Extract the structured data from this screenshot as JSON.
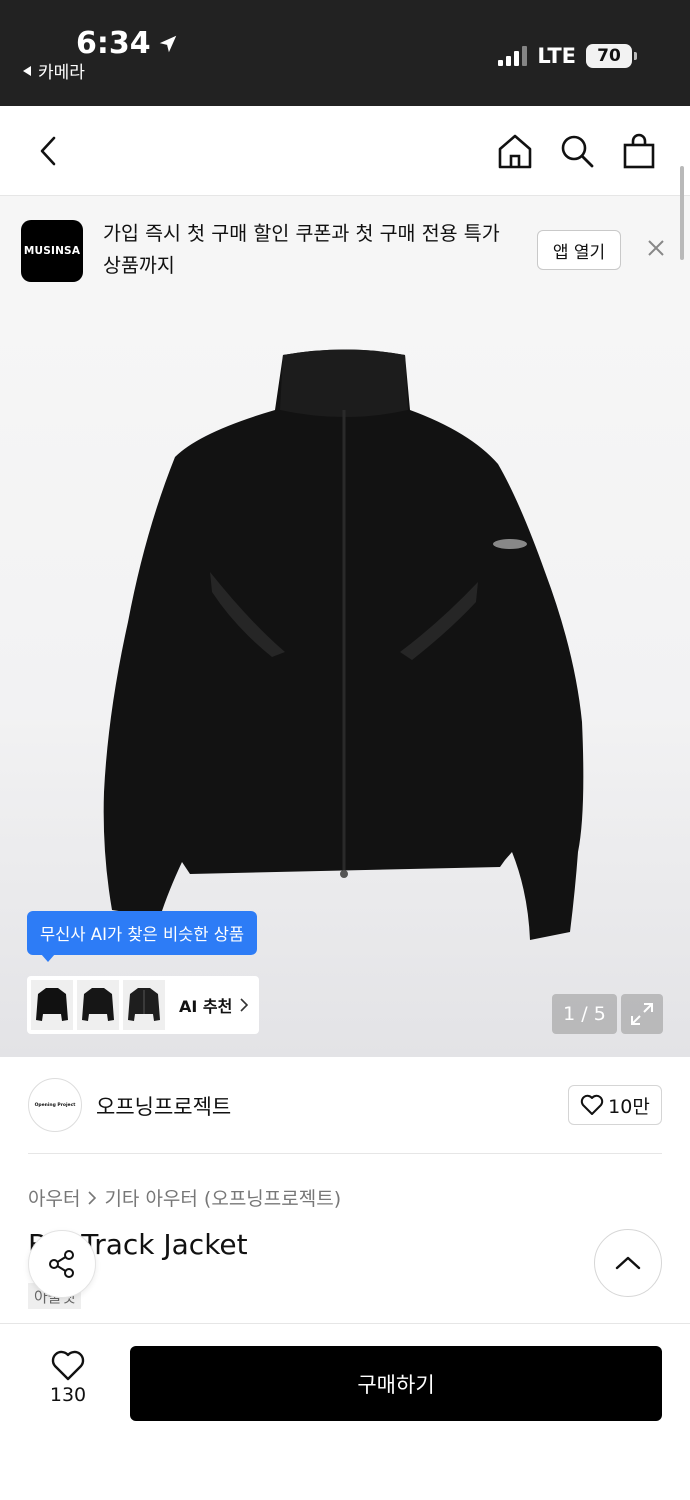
{
  "status_bar": {
    "time": "6:34",
    "back_app": "카메라",
    "network": "LTE",
    "battery": "70"
  },
  "banner": {
    "logo_text": "MUSINSA",
    "message": "가입 즉시 첫 구매 할인 쿠폰과 첫 구매 전용 특가 상품까지",
    "open_app_label": "앱 열기"
  },
  "gallery": {
    "ai_tooltip": "무신사 AI가 찾은 비슷한 상품",
    "ai_recommend_label": "AI 추천",
    "counter": "1 / 5"
  },
  "brand": {
    "logo_text": "Opening Project",
    "name": "오프닝프로젝트",
    "likes": "10만"
  },
  "product": {
    "breadcrumb": [
      "아우터",
      "기타 아우터 (오프닝프로젝트)"
    ],
    "title": "B  k Track Jacket",
    "subtag": "아울렛"
  },
  "bottom_bar": {
    "wish_count": "130",
    "buy_label": "구매하기"
  }
}
